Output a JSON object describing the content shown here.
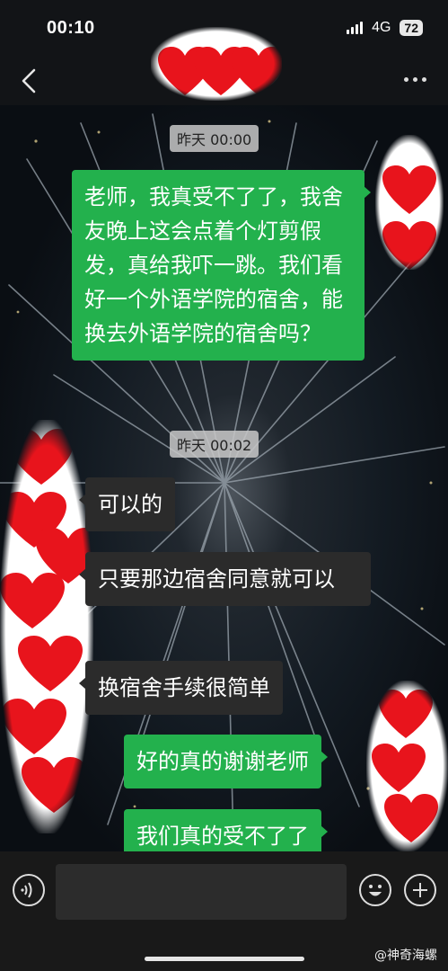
{
  "status_bar": {
    "time": "00:10",
    "network": "4G",
    "battery": "72"
  },
  "nav": {
    "back_icon": "chevron-left-icon",
    "more_icon": "ellipsis-icon"
  },
  "chat": {
    "timestamps": [
      "昨天 00:00",
      "昨天 00:02"
    ],
    "messages": [
      {
        "side": "me",
        "text": "老师，我真受不了了，我舍友晚上这会点着个灯剪假发，真给我吓一跳。我们看好一个外语学院的宿舍，能换去外语学院的宿舍吗？"
      },
      {
        "side": "them",
        "text": "可以的"
      },
      {
        "side": "them",
        "text": "只要那边宿舍同意就可以"
      },
      {
        "side": "them",
        "text": "换宿舍手续很简单"
      },
      {
        "side": "me",
        "text": "好的真的谢谢老师"
      },
      {
        "side": "me",
        "text": "我们真的受不了了"
      }
    ]
  },
  "input_bar": {
    "voice_icon": "voice-icon",
    "emoji_icon": "smiley-icon",
    "plus_icon": "plus-icon"
  },
  "watermark": "@神奇海螺",
  "colors": {
    "my_bubble": "#23b14d",
    "their_bubble": "#2b2b2b",
    "heart": "#e8141c"
  }
}
